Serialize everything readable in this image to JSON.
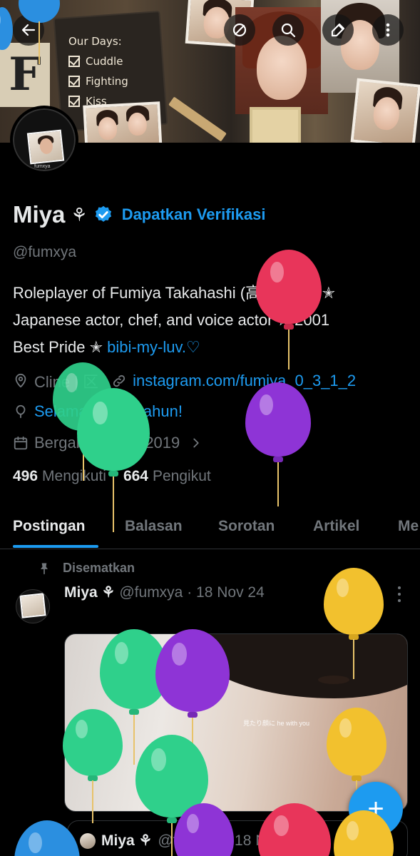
{
  "banner": {
    "notebook_title": "Our Days:",
    "notebook_items": [
      "Cuddle",
      "Fighting",
      "Kiss"
    ],
    "letter": "F"
  },
  "toolbar": {
    "back_icon": "arrow-left-icon",
    "hide_icon": "eye-off-icon",
    "search_icon": "search-icon",
    "edit_icon": "edit-pencil-icon",
    "more_icon": "more-vertical-icon"
  },
  "avatar": {
    "caption": "fumxya"
  },
  "profile": {
    "name": "Miya",
    "name_symbol": "⚘",
    "verify_link": "Dapatkan Verifikasi",
    "handle": "@fumxya",
    "bio_line1": "Roleplayer of Fumiya Takahashi (高橋 文哉) ✭",
    "bio_line2": "Japanese actor, chef, and voice actor ✭ 2001",
    "bio_line3_text": "Best Pride ✭ ",
    "bio_line3_link": "bibi-my-luv.♡",
    "location": "Cline | 区",
    "website": "instagram.com/fumiya_0_3_1_2",
    "birthday": "Selamat ulang tahun!",
    "joined": "Bergabung Mei 2019",
    "following_count": "496",
    "following_label": "Mengikuti",
    "followers_count": "664",
    "followers_label": "Pengikut"
  },
  "tabs": [
    {
      "label": "Postingan",
      "active": true
    },
    {
      "label": "Balasan",
      "active": false
    },
    {
      "label": "Sorotan",
      "active": false
    },
    {
      "label": "Artikel",
      "active": false
    },
    {
      "label": "Me",
      "active": false
    }
  ],
  "post": {
    "pinned_label": "Disematkan",
    "author": "Miya ⚘",
    "meta": "@fumxya · 18 Nov 24",
    "media_caption": "見たり顔に he with you",
    "quote_author": "Miya ⚘",
    "quote_meta": "@fumxya · 18 Nov 24"
  },
  "fab": {
    "label": "+"
  },
  "colors": {
    "accent": "#1d9bf0",
    "text_primary": "#e7e9ea",
    "text_secondary": "#71767b",
    "background": "#000000",
    "balloon_red": "#e8355a",
    "balloon_green": "#2fd08b",
    "balloon_purple": "#8e34d6",
    "balloon_yellow": "#f2c12e",
    "balloon_blue": "#2b8fe0"
  }
}
